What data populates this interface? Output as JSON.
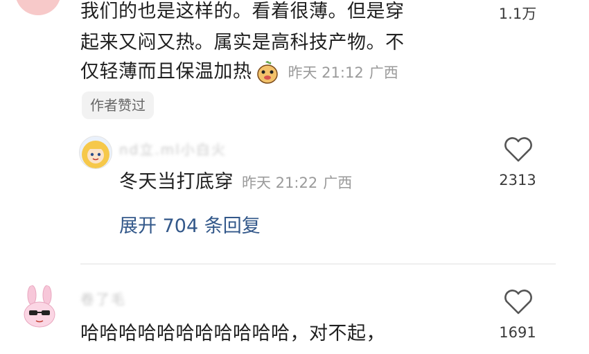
{
  "comment1": {
    "lines": [
      "我们的也是这样的。看着很薄。但是穿",
      "起来又闷又热。属实是高科技产物。不",
      "仅轻薄而且保温加热"
    ],
    "emoji": "radish-face-emoji",
    "time": "昨天 21:12",
    "location": "广西",
    "like_count": "1.1万",
    "author_badge": "作者赞过"
  },
  "reply1": {
    "username": "nd立.ml小白火",
    "text": "冬天当打底穿",
    "time": "昨天 21:22",
    "location": "广西",
    "like_count": "2313"
  },
  "expand_replies": "展开 704 条回复",
  "comment2": {
    "username": "卷了毛",
    "text": "哈哈哈哈哈哈哈哈哈哈哈，对不起，",
    "like_count": "1691"
  },
  "icons": {
    "like": "heart-outline-icon",
    "avatar1": "pink-avatar",
    "avatar2": "blonde-girl-avatar",
    "avatar3": "bunny-sunglasses-avatar"
  },
  "colors": {
    "link": "#33588a",
    "meta": "#9a9a9a"
  }
}
